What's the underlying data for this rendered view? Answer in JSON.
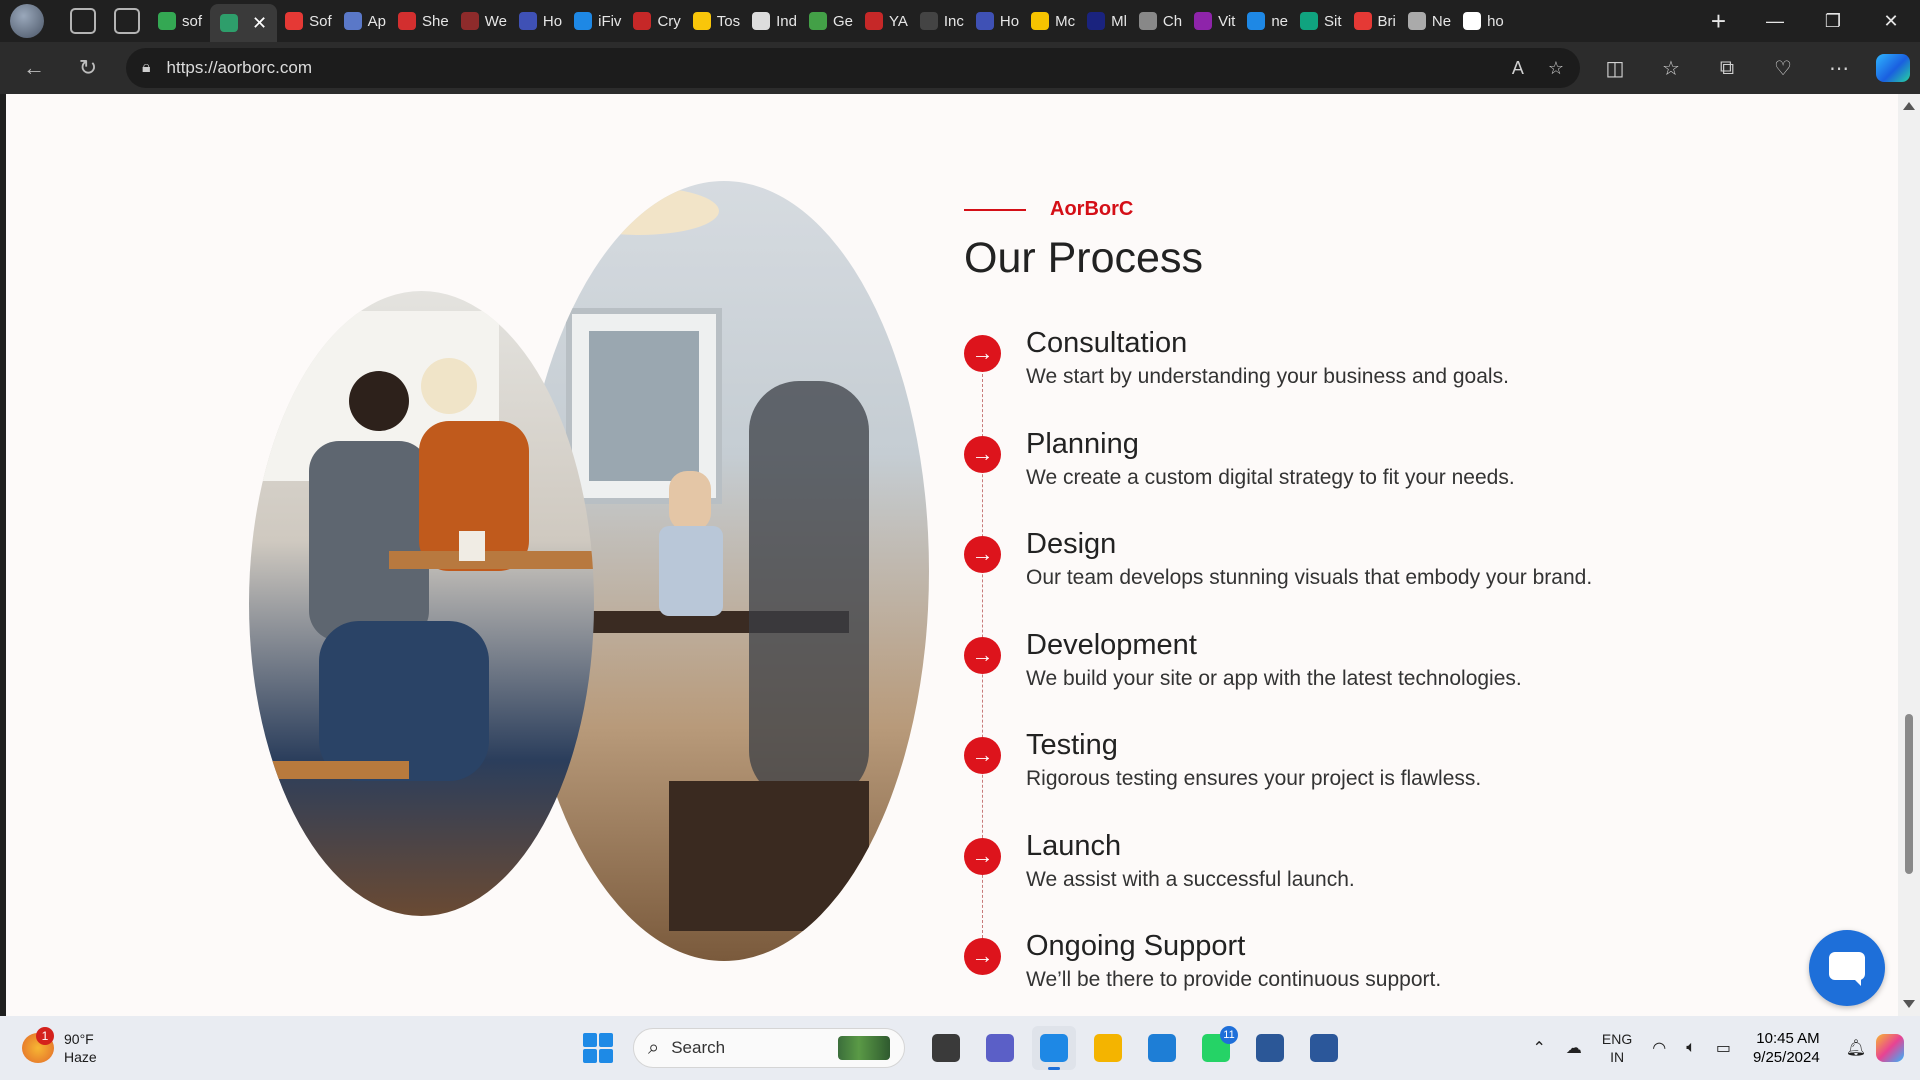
{
  "browser": {
    "tabs": [
      {
        "label": "sof",
        "color": "#34a853"
      },
      {
        "label": "",
        "color": "#2e9e6b",
        "active": true
      },
      {
        "label": "Sof",
        "color": "#e53935"
      },
      {
        "label": "Ap",
        "color": "#5a78c8"
      },
      {
        "label": "She",
        "color": "#d32f2f"
      },
      {
        "label": "We",
        "color": "#8e2b2b"
      },
      {
        "label": "Ho",
        "color": "#3f51b5"
      },
      {
        "label": "iFiv",
        "color": "#1e88e5"
      },
      {
        "label": "Cry",
        "color": "#c62828"
      },
      {
        "label": "Tos",
        "color": "#f9c60a"
      },
      {
        "label": "Ind",
        "color": "#dddddd"
      },
      {
        "label": "Ge",
        "color": "#43a047"
      },
      {
        "label": "YA",
        "color": "#c62828"
      },
      {
        "label": "Inc",
        "color": "#444444"
      },
      {
        "label": "Ho",
        "color": "#3f51b5"
      },
      {
        "label": "Mc",
        "color": "#f7c300"
      },
      {
        "label": "Ml",
        "color": "#1a237e"
      },
      {
        "label": "Ch",
        "color": "#888888"
      },
      {
        "label": "Vit",
        "color": "#8e24aa"
      },
      {
        "label": "ne",
        "color": "#1e88e5"
      },
      {
        "label": "Sit",
        "color": "#10a37f"
      },
      {
        "label": "Bri",
        "color": "#e53935"
      },
      {
        "label": "Ne",
        "color": "#aaaaaa"
      },
      {
        "label": "ho",
        "color": "#ffffff"
      }
    ],
    "close_tab": "✕",
    "new_tab": "+",
    "window_controls": {
      "minimize": "—",
      "restore": "❐",
      "close": "✕"
    },
    "url": "https://aorborc.com"
  },
  "page": {
    "brand": "AorBorC",
    "heading": "Our Process",
    "accent_color": "#d40f17",
    "bullet_glyph": "→",
    "steps": [
      {
        "title": "Consultation",
        "desc": "We start by understanding your business and goals."
      },
      {
        "title": "Planning",
        "desc": "We create a custom digital strategy to fit your needs."
      },
      {
        "title": "Design",
        "desc": "Our team develops stunning visuals that embody your brand."
      },
      {
        "title": "Development",
        "desc": "We build your site or app with the latest technologies."
      },
      {
        "title": "Testing",
        "desc": "Rigorous testing ensures your project is flawless."
      },
      {
        "title": "Launch",
        "desc": "We assist with a successful launch."
      },
      {
        "title": "Ongoing Support",
        "desc": "We’ll be there to provide continuous support."
      }
    ]
  },
  "taskbar": {
    "weather": {
      "temp": "90°F",
      "condition": "Haze",
      "badge": "1"
    },
    "search_label": "Search",
    "whatsapp_count": "11",
    "lang": {
      "line1": "ENG",
      "line2": "IN"
    },
    "clock": {
      "time": "10:45 AM",
      "date": "9/25/2024"
    },
    "apps": [
      {
        "name": "task-view-app",
        "color": "#3a3a3a"
      },
      {
        "name": "teams-app",
        "color": "#5b5fc7"
      },
      {
        "name": "edge-app",
        "color": "#1e88e5",
        "selected": true
      },
      {
        "name": "file-explorer-app",
        "color": "#f4b400"
      },
      {
        "name": "vscode-app",
        "color": "#1e7ed6"
      },
      {
        "name": "whatsapp-app",
        "color": "#25d366"
      },
      {
        "name": "snipping-tool-app",
        "color": "#2b5797"
      },
      {
        "name": "word-app",
        "color": "#2b579a"
      }
    ]
  }
}
